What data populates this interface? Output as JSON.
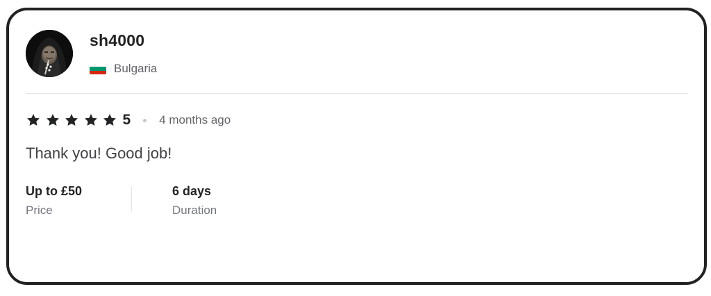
{
  "reviewer": {
    "username": "sh4000",
    "country": "Bulgaria",
    "flag_colors": [
      "#ffffff",
      "#00966e",
      "#d62612"
    ],
    "avatar_icon": "hooded-figure-avatar"
  },
  "review": {
    "rating": 5,
    "rating_label": "5",
    "star_count": 5,
    "star_color": "#222325",
    "time_ago": "4 months ago",
    "text": "Thank you! Good job!"
  },
  "details": {
    "price": {
      "value": "Up to £50",
      "label": "Price"
    },
    "duration": {
      "value": "6 days",
      "label": "Duration"
    }
  }
}
